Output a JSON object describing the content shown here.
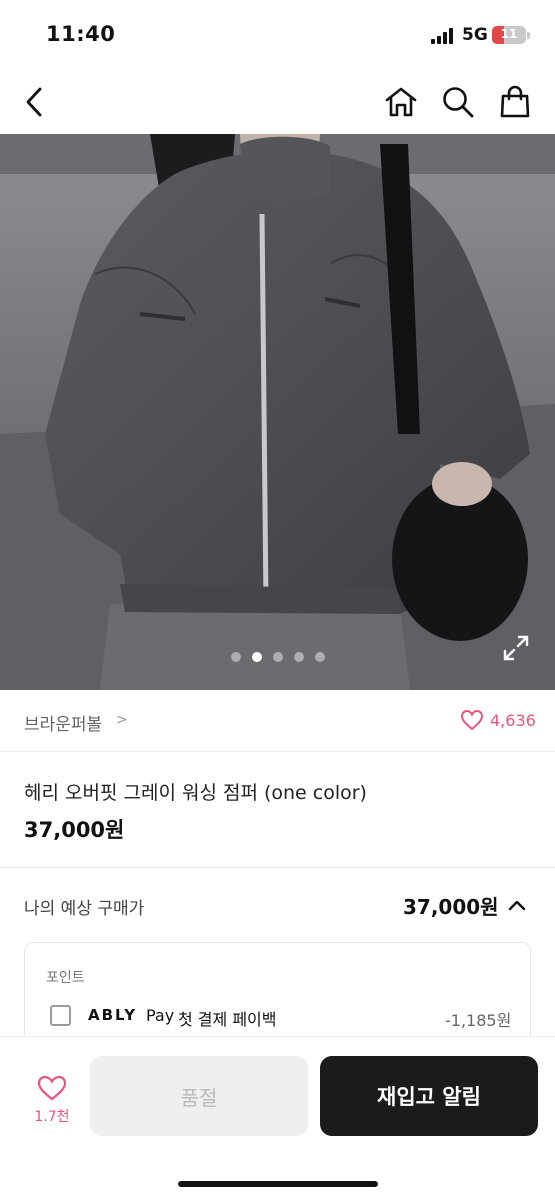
{
  "status_bar": {
    "time": "11:40",
    "network": "5G",
    "battery": "11"
  },
  "product": {
    "brand": "브라운퍼볼",
    "brand_chevron": ">",
    "likes": "4,636",
    "title": "헤리 오버핏 그레이 워싱 점퍼 (one color)",
    "price": "37,000원",
    "image_count": 5,
    "image_index": 2
  },
  "expected_price": {
    "label": "나의 예상 구매가",
    "value": "37,000원"
  },
  "points": {
    "section_label": "포인트",
    "item": {
      "logo": "ABLY",
      "pay": "Pay",
      "desc": "첫 결제 페이백",
      "amount": "-1,185원",
      "checked": false
    }
  },
  "bottom_bar": {
    "wish_count": "1.7천",
    "soldout_label": "품절",
    "restock_label": "재입고 알림"
  },
  "colors": {
    "accent_pink": "#e8567a",
    "dark_button": "#1b1b1b",
    "disabled_button": "#efefef"
  },
  "icons": [
    "back-icon",
    "home-icon",
    "search-icon",
    "cart-bag-icon",
    "expand-icon",
    "heart-icon",
    "chevron-up-icon"
  ]
}
